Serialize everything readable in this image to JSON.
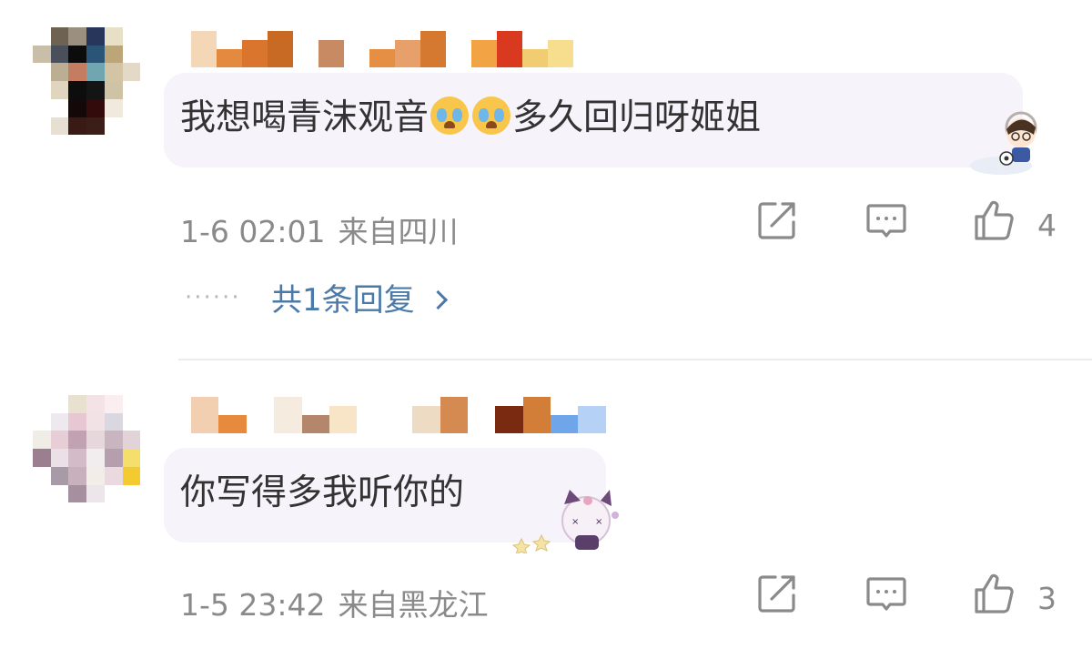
{
  "comments": [
    {
      "text_before": "我想喝青沫观音",
      "text_after": "多久回归呀姬姐",
      "emoji_names": [
        "crying-face-emoji",
        "crying-face-emoji"
      ],
      "time": "1-6 02:01",
      "location": "来自四川",
      "likes": "4",
      "replies": "共1条回复",
      "avatar_tiles": [
        "#ffffff",
        "#6e6250",
        "#9b8f7f",
        "#27365a",
        "#e8dfc7",
        "#ffffff",
        "#ffffff",
        "#c9bfa9",
        "#4a4f5c",
        "#0c0c0c",
        "#2b5577",
        "#bda57a",
        "#ffffff",
        "#ffffff",
        "#ffffff",
        "#bcae93",
        "#c57d62",
        "#6fa6b0",
        "#d2c4a4",
        "#e4d9c6",
        "#ffffff",
        "#ffffff",
        "#e0d6c0",
        "#0d0d0d",
        "#141414",
        "#cfc3a6",
        "#ffffff",
        "#ffffff",
        "#ffffff",
        "#ffffff",
        "#150808",
        "#330b0b",
        "#f0e9dd",
        "#ffffff",
        "#ffffff",
        "#ffffff",
        "#e6dfd2",
        "#3a1a14",
        "#3c1e18",
        "#ffffff",
        "#ffffff",
        "#ffffff",
        "#ffffff",
        "#ffffff",
        "#ffffff",
        "#ffffff",
        "#ffffff",
        "#ffffff",
        "#ffffff"
      ],
      "username_tiles": [
        "#f3d7b6",
        "#e48a3e",
        "#d9752d",
        "#c96a24",
        "#ffffff",
        "#c88a63",
        "#ffffff",
        "#e58f45",
        "#e8a06a",
        "#d57930",
        "#ffffff",
        "#f2a445",
        "#d9391e",
        "#f2cc70",
        "#f7de8e"
      ]
    },
    {
      "text": "你写得多我听你的",
      "time": "1-5 23:42",
      "location": "来自黑龙江",
      "likes": "3",
      "avatar_tiles": [
        "#ffffff",
        "#ffffff",
        "#e9e1cf",
        "#f3e3e6",
        "#fbeef0",
        "#ffffff",
        "#ffffff",
        "#ffffff",
        "#eee9ef",
        "#e6c7d2",
        "#f0e2e5",
        "#dad7e0",
        "#ffffff",
        "#ffffff",
        "#f0ece6",
        "#e6cdd6",
        "#c0a2b2",
        "#e5d7dc",
        "#c9b5bf",
        "#e2d3d8",
        "#ffffff",
        "#9b7e90",
        "#ebe0e6",
        "#d3bcc8",
        "#f1ecee",
        "#b59fae",
        "#f4df6c",
        "#ffffff",
        "#ffffff",
        "#a89aa6",
        "#c6b1bc",
        "#f2ede9",
        "#ebd9e0",
        "#f3cb30",
        "#ffffff",
        "#ffffff",
        "#ffffff",
        "#a68f9e",
        "#ece6ea",
        "#ffffff",
        "#ffffff",
        "#ffffff",
        "#ffffff",
        "#ffffff",
        "#ffffff",
        "#ffffff",
        "#ffffff",
        "#ffffff",
        "#ffffff"
      ],
      "username_tiles": [
        "#f2cfb0",
        "#e88a3e",
        "#ffffff",
        "#f5ebde",
        "#b4876c",
        "#f8e4c7",
        "#ffffff",
        "#ffffff",
        "#eddcc3",
        "#d58a52",
        "#ffffff",
        "#7b2a12",
        "#d37e38",
        "#6fa5e9",
        "#b5d1f5"
      ]
    }
  ],
  "icons": {
    "share": "share-icon",
    "comment": "comment-icon",
    "like": "thumbs-up-icon",
    "chevron": "chevron-right-icon"
  },
  "colors": {
    "text": "#333333",
    "meta": "#8a8a8a",
    "link": "#4b7aa8",
    "bubble": "#f6f3fa"
  }
}
